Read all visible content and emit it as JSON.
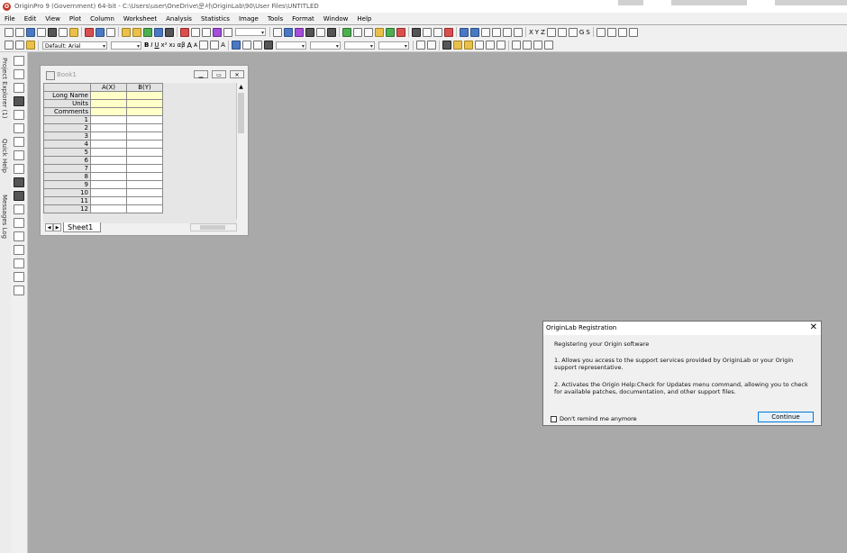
{
  "window": {
    "title": "OriginPro 9 (Government) 64-bit - C:\\Users\\user\\OneDrive\\문서\\OriginLab\\90\\User Files\\UNTITLED"
  },
  "menu": [
    "File",
    "Edit",
    "View",
    "Plot",
    "Column",
    "Worksheet",
    "Analysis",
    "Statistics",
    "Image",
    "Tools",
    "Format",
    "Window",
    "Help"
  ],
  "toolbar": {
    "font_name": "Default: Arial",
    "bold": "B",
    "italic": "I",
    "underline": "U",
    "superscript": "x²",
    "subscript": "x₂",
    "greek": "αβ",
    "font_bigger": "A",
    "font_smaller": "A",
    "axis_x": "X",
    "axis_y": "Y",
    "axis_z": "Z",
    "grid_g": "G",
    "grid_s": "S"
  },
  "side_tabs": [
    "Project Explorer (1)",
    "Quick Help",
    "Messages Log"
  ],
  "book": {
    "title": "Book1",
    "columns": [
      "A(X)",
      "B(Y)"
    ],
    "meta_rows": [
      "Long Name",
      "Units",
      "Comments"
    ],
    "rows": [
      "1",
      "2",
      "3",
      "4",
      "5",
      "6",
      "7",
      "8",
      "9",
      "10",
      "11",
      "12"
    ],
    "sheet_tab": "Sheet1"
  },
  "dialog": {
    "title": "OriginLab Registration",
    "heading": "Registering your Origin software",
    "item1": "1. Allows you access to the support services provided by OriginLab or your Origin support representative.",
    "item2": "2. Activates the Origin Help:Check for Updates menu command, allowing you to check for available patches, documentation, and other support files.",
    "checkbox": "Don't remind me anymore",
    "button": "Continue"
  }
}
